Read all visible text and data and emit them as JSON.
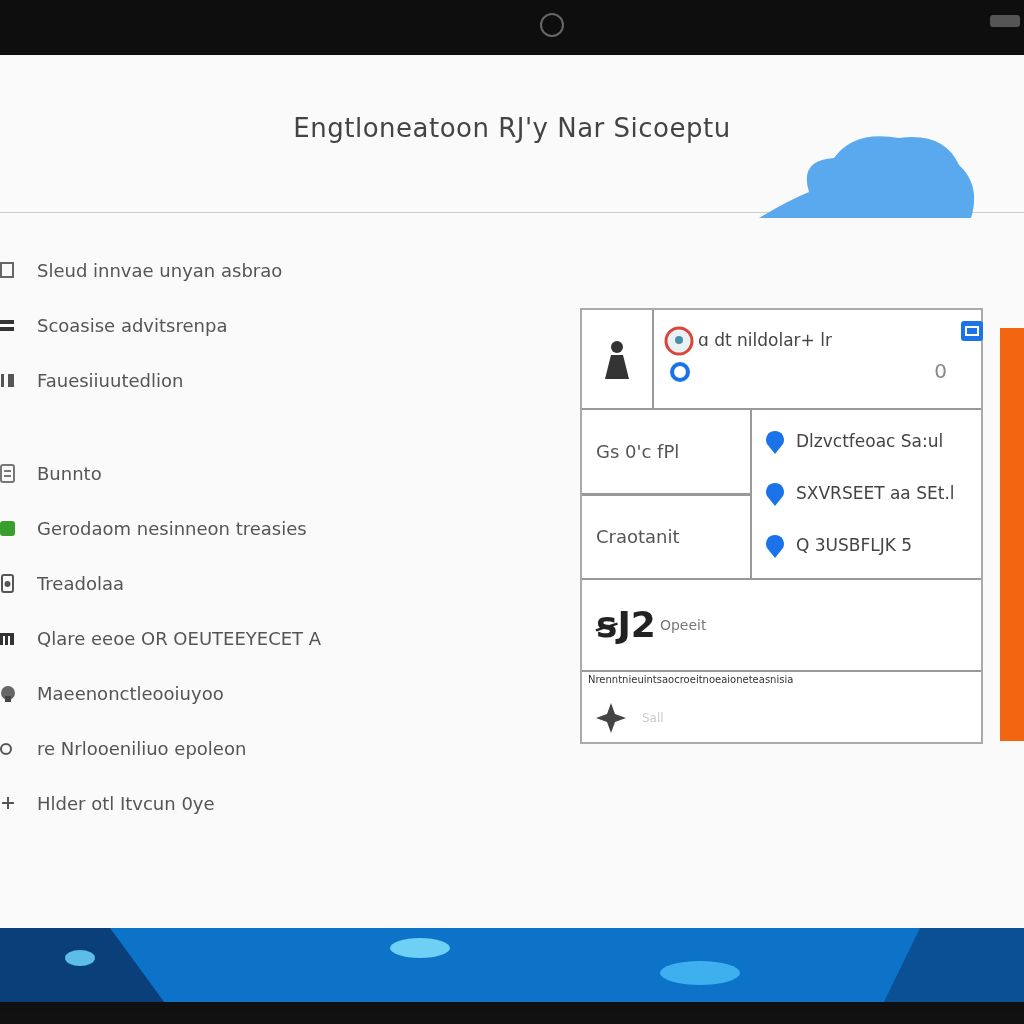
{
  "window": {
    "title": "Engtloneatoon RJ'y Nar Sicoeptu"
  },
  "sidebar": {
    "groups": [
      {
        "items": [
          {
            "label": "Sleud innvae unyan asbrao"
          },
          {
            "label": "Scoasise advitsrenpa"
          },
          {
            "label": "Fauesiiuutedlion"
          }
        ]
      },
      {
        "items": [
          {
            "label": "Bunnto"
          },
          {
            "label": "Gerodaom nesinneon treasies"
          },
          {
            "label": "Treadolaa"
          },
          {
            "label": "Qlare eeoe OR OEUTEEYECET A"
          },
          {
            "label": "Maeenonctleooiuyoo"
          },
          {
            "label": "re Nrlooeniliuo epoleon"
          },
          {
            "label": "Hlder otl Itvcun 0ye"
          }
        ]
      }
    ]
  },
  "panel": {
    "header": {
      "name": "ɑ dt nildolar+ lr",
      "info": "0"
    },
    "left_cells": [
      "Gs 0'c fPl",
      "Craotanit"
    ],
    "places": [
      "Dlzvctfeoac Sa:ul",
      "SXVRSEET aa SEt.l",
      "Q 3USBFLJK 5"
    ],
    "stat": {
      "value": "ꞩJ2",
      "label": "Opeeit"
    },
    "footnote": "Nrenntnieuintsaocroeitnoeaioneteasnisia",
    "footer_label": "Sall"
  }
}
